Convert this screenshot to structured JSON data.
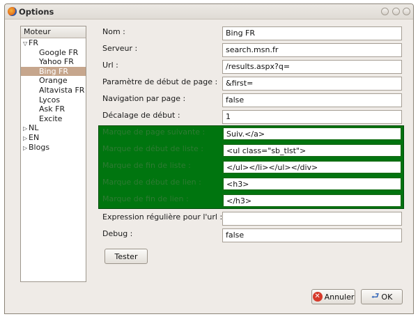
{
  "window": {
    "title": "Options",
    "icon": "firefox-icon"
  },
  "engine_list": {
    "header": "Moteur",
    "rows": [
      {
        "label": "FR",
        "kind": "group",
        "expanded": true
      },
      {
        "label": "Google FR",
        "kind": "child"
      },
      {
        "label": "Yahoo FR",
        "kind": "child"
      },
      {
        "label": "Bing FR",
        "kind": "child",
        "selected": true
      },
      {
        "label": "Orange",
        "kind": "child"
      },
      {
        "label": "Altavista FR",
        "kind": "child"
      },
      {
        "label": "Lycos",
        "kind": "child"
      },
      {
        "label": "Ask FR",
        "kind": "child"
      },
      {
        "label": "Excite",
        "kind": "child"
      },
      {
        "label": "NL",
        "kind": "group",
        "expanded": false
      },
      {
        "label": "EN",
        "kind": "group",
        "expanded": false
      },
      {
        "label": "Blogs",
        "kind": "group",
        "expanded": false
      }
    ]
  },
  "form": {
    "fields": [
      {
        "label": "Nom :",
        "value": "Bing FR"
      },
      {
        "label": "Serveur :",
        "value": "search.msn.fr"
      },
      {
        "label": "Url :",
        "value": "/results.aspx?q="
      },
      {
        "label": "Paramètre de début de page :",
        "value": "&first="
      },
      {
        "label": "Navigation par page :",
        "value": "false"
      },
      {
        "label": "Décalage de début :",
        "value": "1"
      },
      {
        "label": "Marque de page suivante :",
        "value": "Suiv.</a>"
      },
      {
        "label": "Marque de début de liste :",
        "value": "<ul class=\"sb_tlst\">"
      },
      {
        "label": "Marque de fin de liste :",
        "value": "</ul></li></ul></div>"
      },
      {
        "label": "Marque de début de lien :",
        "value": "<h3>"
      },
      {
        "label": "Marque de fin de lien :",
        "value": "</h3>"
      },
      {
        "label": "Expression régulière pour l'url :",
        "value": ""
      },
      {
        "label": "Debug :",
        "value": "false"
      }
    ],
    "test_button": "Tester"
  },
  "footer": {
    "cancel_label": "Annuler",
    "ok_label": "OK"
  },
  "colors": {
    "selection": "#c6a68d",
    "highlight_block": "#00750f",
    "highlight_label": "#2e7b33"
  }
}
